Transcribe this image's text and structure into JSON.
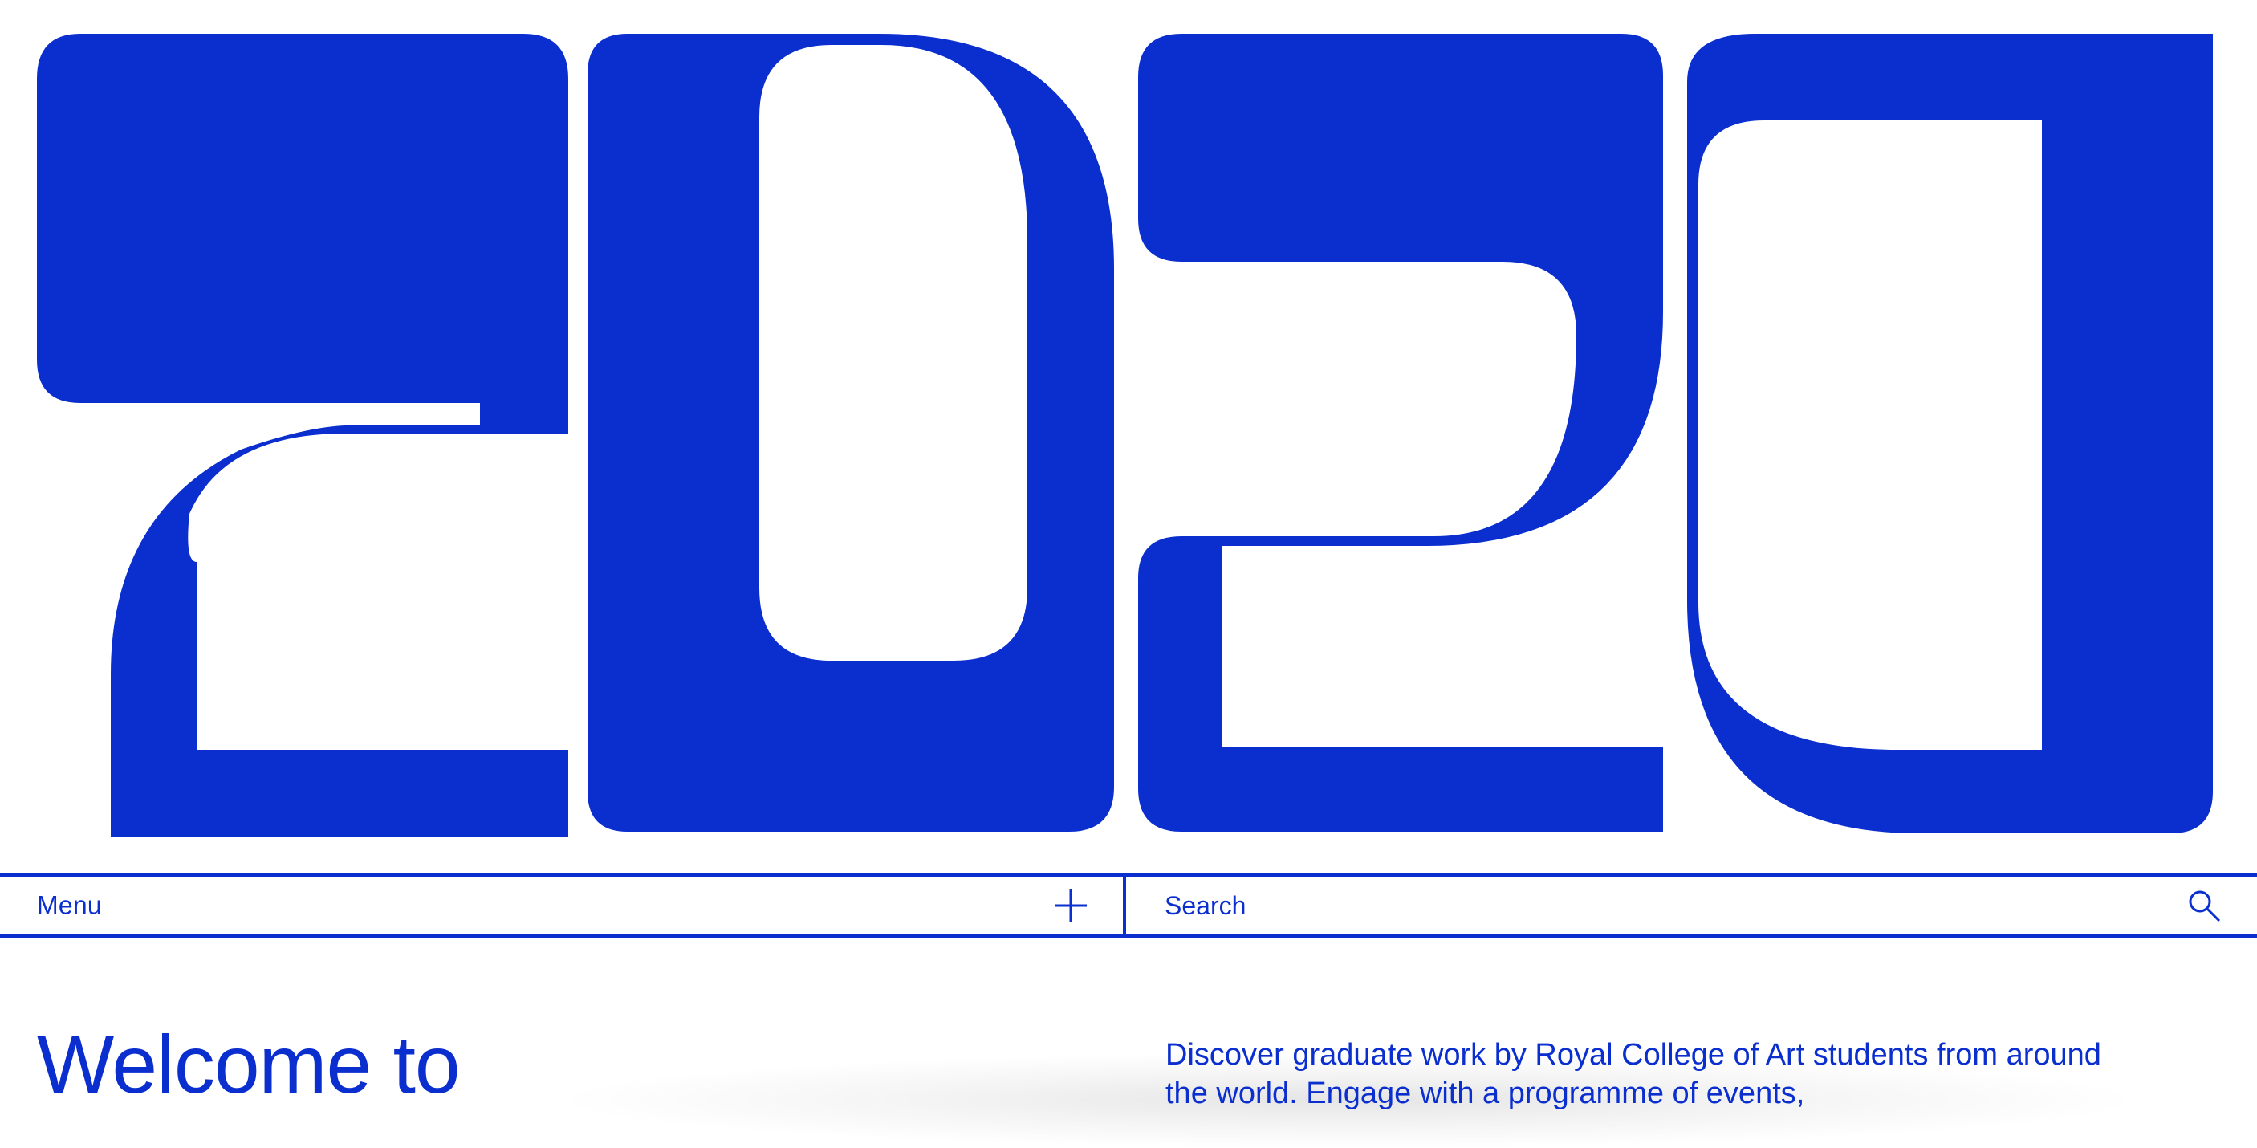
{
  "brand": {
    "hero_text": "2020",
    "accent_color": "#0b2fcf",
    "background_color": "#ffffff"
  },
  "nav": {
    "menu_label": "Menu",
    "menu_icon": "plus-icon",
    "search_placeholder": "Search",
    "search_icon": "search-icon"
  },
  "content": {
    "welcome_heading": "Welcome to",
    "intro_text": "Discover graduate work by Royal College of Art students from around the world. Engage with a programme of events,"
  }
}
